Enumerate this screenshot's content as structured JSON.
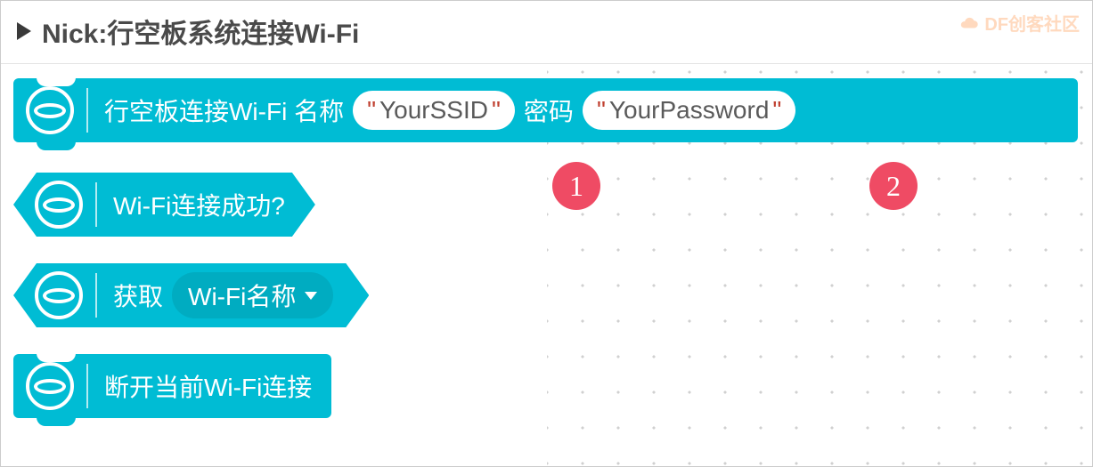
{
  "header": {
    "title": "Nick:行空板系统连接Wi-Fi"
  },
  "watermark": {
    "text": "DF创客社区"
  },
  "blocks": {
    "connect": {
      "label_prefix": "行空板连接Wi-Fi 名称",
      "ssid_value": "YourSSID",
      "label_mid": "密码",
      "password_value": "YourPassword"
    },
    "check": {
      "label": "Wi-Fi连接成功?"
    },
    "get": {
      "label": "获取",
      "dropdown_selected": "Wi-Fi名称"
    },
    "disconnect": {
      "label": "断开当前Wi-Fi连接"
    }
  },
  "badges": {
    "one": "1",
    "two": "2"
  }
}
